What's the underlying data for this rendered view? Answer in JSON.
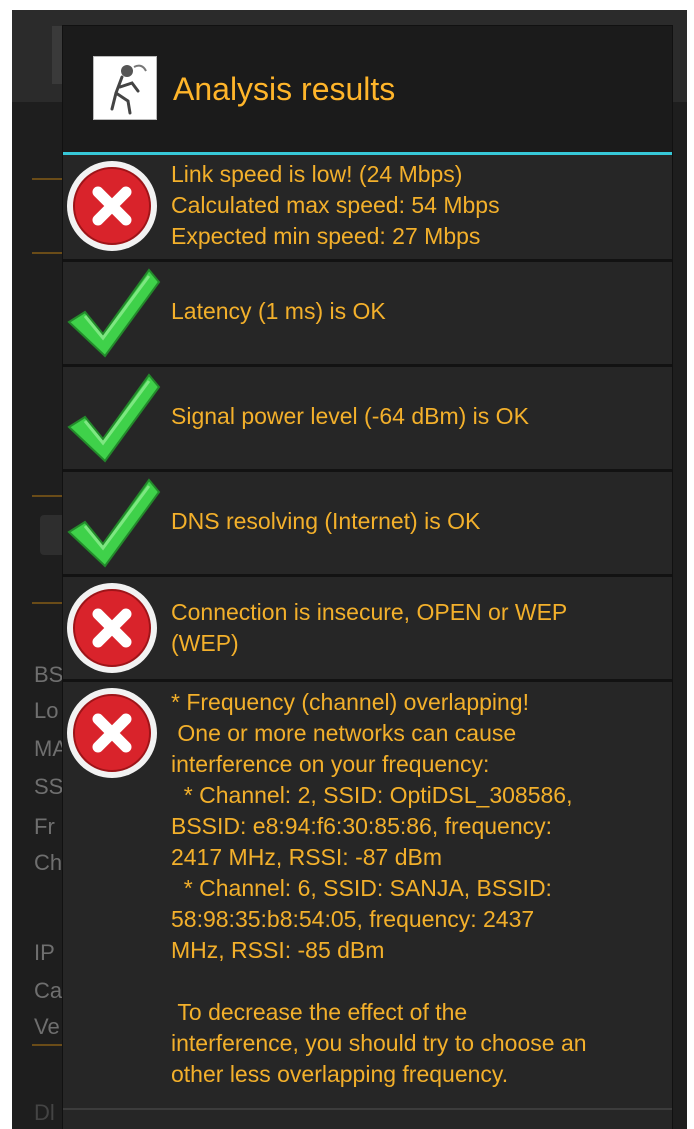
{
  "dialog": {
    "title": "Analysis results",
    "results": [
      {
        "status": "fail",
        "icon": "error-x-icon",
        "text": "Link speed is low! (24 Mbps)\nCalculated max speed: 54 Mbps\nExpected min speed: 27 Mbps"
      },
      {
        "status": "ok",
        "icon": "checkmark-icon",
        "text": "Latency (1 ms) is OK"
      },
      {
        "status": "ok",
        "icon": "checkmark-icon",
        "text": "Signal power level (-64 dBm) is OK"
      },
      {
        "status": "ok",
        "icon": "checkmark-icon",
        "text": "DNS resolving (Internet) is OK"
      },
      {
        "status": "fail",
        "icon": "error-x-icon",
        "text": "Connection is insecure, OPEN or WEP\n(WEP)"
      },
      {
        "status": "fail",
        "icon": "error-x-icon",
        "text": "* Frequency (channel) overlapping!\n One or more networks can cause\ninterference on your frequency:\n  * Channel: 2, SSID: OptiDSL_308586,\nBSSID: e8:94:f6:30:85:86, frequency:\n2417 MHz, RSSI: -87 dBm\n  * Channel: 6, SSID: SANJA, BSSID:\n58:98:35:b8:54:05, frequency: 2437\nMHz, RSSI: -85 dBm\n\n To decrease the effect of the\ninterference, you should try to choose an\nother less overlapping frequency."
      }
    ]
  },
  "background": {
    "labels": [
      "BS",
      "Lo",
      "MA",
      "SS",
      "Fr",
      "Ch",
      "IP",
      "Ca",
      "Ve",
      "Dl"
    ]
  },
  "colors": {
    "accent_text": "#f3b02b",
    "divider": "#37c8d8",
    "ok_green": "#3fd14a",
    "fail_red": "#d9232b"
  }
}
